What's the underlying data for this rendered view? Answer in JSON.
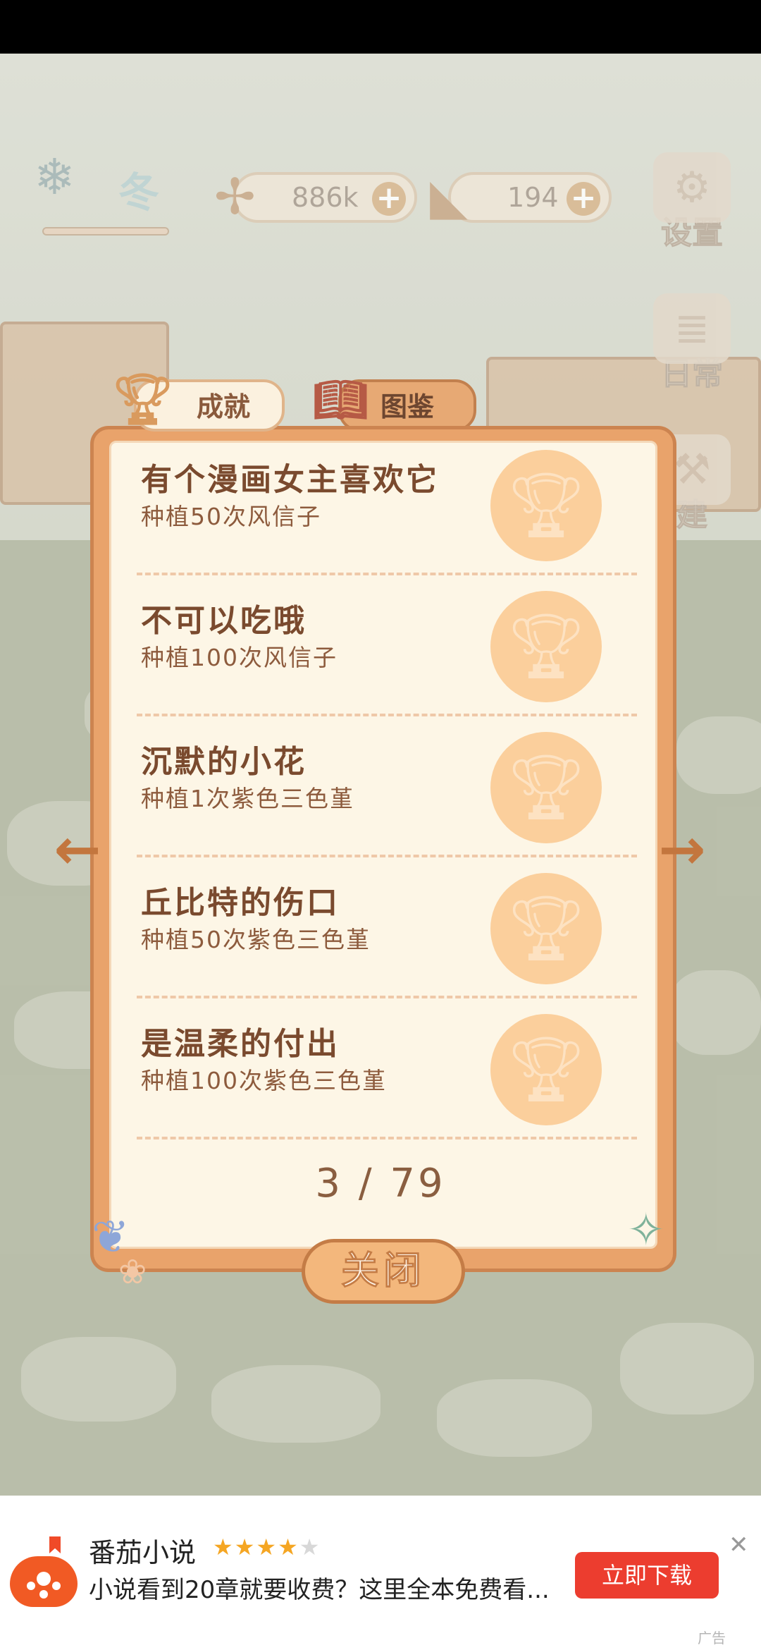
{
  "hud": {
    "season_label": "冬",
    "fish_count": "886k",
    "cheese_count": "194",
    "settings_label": "设置",
    "daily_label": "日常",
    "build_label": "建"
  },
  "tabs": {
    "achievements": "成就",
    "collection": "图鉴"
  },
  "achievements": [
    {
      "title": "有个漫画女主喜欢它",
      "desc": "种植50次风信子"
    },
    {
      "title": "不可以吃哦",
      "desc": "种植100次风信子"
    },
    {
      "title": "沉默的小花",
      "desc": "种植1次紫色三色堇"
    },
    {
      "title": "丘比特的伤口",
      "desc": "种植50次紫色三色堇"
    },
    {
      "title": "是温柔的付出",
      "desc": "种植100次紫色三色堇"
    }
  ],
  "pagination": "3 / 79",
  "close_label": "关闭",
  "ad": {
    "app_name": "番茄小说",
    "rating_stars": 4,
    "description": "小说看到20章就要收费？这里全本免费看...",
    "cta_label": "立即下载",
    "tag": "广告",
    "brand_color": "#ec3d2f"
  },
  "colors": {
    "panel": "#e9a36b",
    "panel_inner": "#fdf6e6",
    "text": "#7a4a2e",
    "medal": "#fbcf9c"
  }
}
